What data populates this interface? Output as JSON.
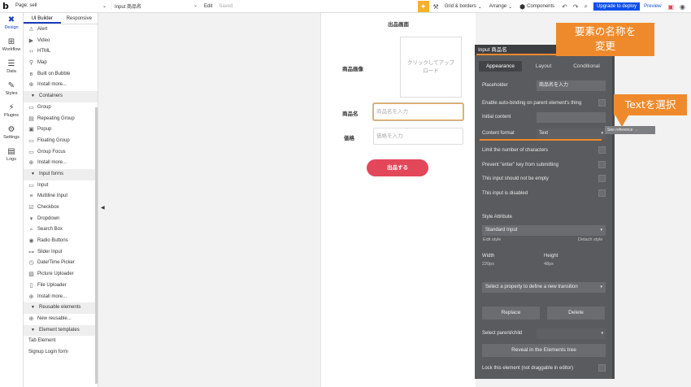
{
  "topbar": {
    "page_select": "Page: sell",
    "element_name": "Input 商品名",
    "edit": "Edit",
    "saved": "Saved",
    "grid_borders": "Grid & borders",
    "arrange": "Arrange",
    "components": "Components",
    "upgrade": "Upgrade to deploy",
    "preview": "Preview"
  },
  "rail": [
    {
      "label": "Design",
      "icon": "design-icon"
    },
    {
      "label": "Workflow",
      "icon": "workflow-icon"
    },
    {
      "label": "Data",
      "icon": "data-icon"
    },
    {
      "label": "Styles",
      "icon": "styles-icon"
    },
    {
      "label": "Plugins",
      "icon": "plugins-icon"
    },
    {
      "label": "Settings",
      "icon": "settings-icon"
    },
    {
      "label": "Logs",
      "icon": "logs-icon"
    }
  ],
  "palette": {
    "tabs": [
      "UI Builder",
      "Responsive"
    ],
    "rows": [
      {
        "type": "item",
        "label": "Alert",
        "glyph": "⚠"
      },
      {
        "type": "item",
        "label": "Video",
        "glyph": "▶"
      },
      {
        "type": "item",
        "label": "HTML",
        "glyph": "‹›"
      },
      {
        "type": "item",
        "label": "Map",
        "glyph": "⚲"
      },
      {
        "type": "item",
        "label": "Built on Bubble",
        "glyph": "ʙ"
      },
      {
        "type": "item",
        "label": "Install more...",
        "glyph": "⊕"
      },
      {
        "type": "head",
        "label": "Containers"
      },
      {
        "type": "item",
        "label": "Group",
        "glyph": "▭"
      },
      {
        "type": "item",
        "label": "Repeating Group",
        "glyph": "▤"
      },
      {
        "type": "item",
        "label": "Popup",
        "glyph": "▣"
      },
      {
        "type": "item",
        "label": "Floating Group",
        "glyph": "▭"
      },
      {
        "type": "item",
        "label": "Group Focus",
        "glyph": "▭"
      },
      {
        "type": "item",
        "label": "Install more...",
        "glyph": "⊕"
      },
      {
        "type": "head",
        "label": "Input forms"
      },
      {
        "type": "item",
        "label": "Input",
        "glyph": "▭"
      },
      {
        "type": "item",
        "label": "Multiline Input",
        "glyph": "≡"
      },
      {
        "type": "item",
        "label": "Checkbox",
        "glyph": "☑"
      },
      {
        "type": "item",
        "label": "Dropdown",
        "glyph": "▾"
      },
      {
        "type": "item",
        "label": "Search Box",
        "glyph": "⌕"
      },
      {
        "type": "item",
        "label": "Radio Buttons",
        "glyph": "◉"
      },
      {
        "type": "item",
        "label": "Slider Input",
        "glyph": "⊶"
      },
      {
        "type": "item",
        "label": "Date/Time Picker",
        "glyph": "◷"
      },
      {
        "type": "item",
        "label": "Picture Uploader",
        "glyph": "▨"
      },
      {
        "type": "item",
        "label": "File Uploader",
        "glyph": "▯"
      },
      {
        "type": "item",
        "label": "Install more...",
        "glyph": "⊕"
      },
      {
        "type": "head",
        "label": "Reusable elements"
      },
      {
        "type": "item",
        "label": "New reusable...",
        "glyph": "⊕"
      },
      {
        "type": "head",
        "label": "Element templates"
      },
      {
        "type": "plain",
        "label": "Tab Element"
      },
      {
        "type": "plain",
        "label": "Signup Login form"
      }
    ]
  },
  "canvas": {
    "page_title": "出品画面",
    "label_image": "商品画像",
    "upload_text": "クリックしてアップロード",
    "label_name": "商品名",
    "name_placeholder": "商品名を入力",
    "label_price": "価格",
    "price_placeholder": "価格を入力",
    "submit": "出品する"
  },
  "prop": {
    "header": "Input 商品名",
    "tabs": [
      "Appearance",
      "Layout",
      "Conditional"
    ],
    "placeholder_label": "Placeholder",
    "placeholder_value": "商品名を入力",
    "auto_binding": "Enable auto-binding on parent element's thing",
    "initial_content": "Initial content",
    "content_format": "Content format",
    "content_format_value": "Text",
    "see_reference": "See reference →",
    "limit_chars": "Limit the number of characters",
    "prevent_enter": "Prevent \"enter\" key from submitting",
    "not_empty": "This input should not be empty",
    "disabled": "This input is disabled",
    "style_attribute": "Style Attribute",
    "style_value": "Standard Input",
    "edit_style": "Edit style",
    "detach_style": "Detach style",
    "width_label": "Width",
    "width_value": "220px",
    "height_label": "Height",
    "height_value": "48px",
    "transition": "Select a property to define a new transition",
    "replace": "Replace",
    "delete": "Delete",
    "select_parent": "Select parent/child",
    "reveal": "Reveal in the Elements tree",
    "lock": "Lock this element (not draggable in editor)"
  },
  "annotations": {
    "rename": "要素の名称を\n変更",
    "select_text": "Textを選択"
  },
  "colors": {
    "accent": "#ef8a2c",
    "brand_blue": "#0d4fe8",
    "submit_red": "#e2485a",
    "panel": "#5a5b5e"
  }
}
